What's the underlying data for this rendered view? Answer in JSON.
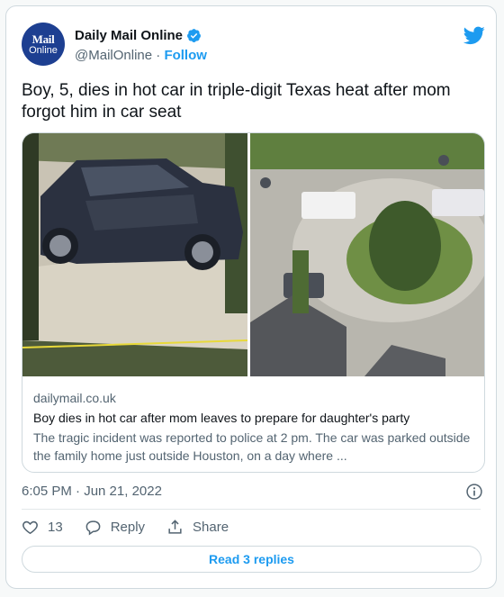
{
  "author": {
    "avatar_line1": "Mail",
    "avatar_line2": "Online",
    "display_name": "Daily Mail Online",
    "handle": "@MailOnline",
    "separator": " · ",
    "follow_label": "Follow",
    "verified_icon": "verified-badge-icon",
    "brand_icon": "twitter-bird-icon"
  },
  "tweet": {
    "text": "Boy, 5, dies in hot car in triple-digit Texas heat after mom forgot him in car seat",
    "timestamp": "6:05 PM · Jun 21, 2022"
  },
  "card": {
    "domain": "dailymail.co.uk",
    "title": "Boy dies in hot car after mom leaves to prepare for daughter's party",
    "description": "The tragic incident was reported to police at 2 pm. The car was parked outside the family home just outside Houston, on a day where ..."
  },
  "actions": {
    "likes_count": "13",
    "reply_label": "Reply",
    "share_label": "Share",
    "read_replies_label": "Read 3 replies"
  },
  "colors": {
    "accent": "#1d9bf0",
    "avatar_bg": "#1d3f91",
    "secondary_text": "#536471",
    "border": "#cfd9de"
  }
}
